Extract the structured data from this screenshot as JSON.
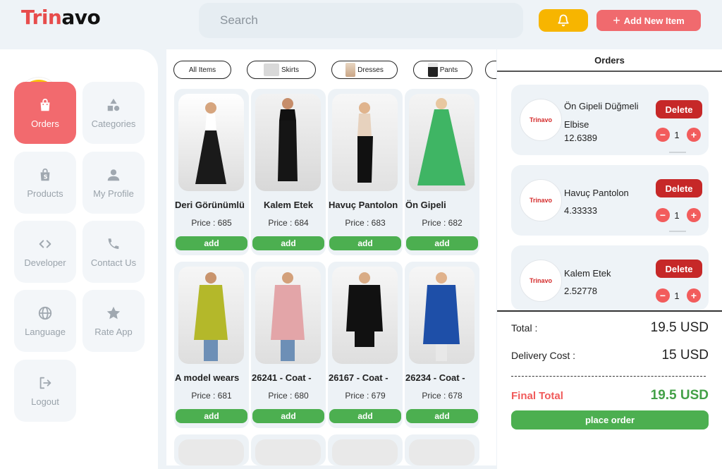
{
  "brand": {
    "part1": "Trin",
    "part2": "avo"
  },
  "search": {
    "placeholder": "Search"
  },
  "header": {
    "bell_icon": "bell-icon",
    "add_new_label": "Add New Item"
  },
  "sidebar": {
    "items": [
      {
        "label": "Orders",
        "icon": "bag-icon",
        "active": true
      },
      {
        "label": "Categories",
        "icon": "shapes-icon"
      },
      {
        "label": "Products",
        "icon": "shopify-bag-icon"
      },
      {
        "label": "My Profile",
        "icon": "user-icon"
      },
      {
        "label": "Developer",
        "icon": "code-icon"
      },
      {
        "label": "Contact Us",
        "icon": "phone-icon"
      },
      {
        "label": "Language",
        "icon": "globe-icon"
      },
      {
        "label": "Rate App",
        "icon": "star-icon"
      },
      {
        "label": "Logout",
        "icon": "logout-icon"
      }
    ]
  },
  "categories": [
    "All Items",
    "Skirts",
    "Dresses",
    "Pants"
  ],
  "products": [
    {
      "name": "Deri Görünümlü",
      "price_label": "Price : 685",
      "add": "add"
    },
    {
      "name": "Kalem Etek",
      "price_label": "Price : 684",
      "add": "add"
    },
    {
      "name": "Havuç Pantolon",
      "price_label": "Price : 683",
      "add": "add"
    },
    {
      "name": "Ön Gipeli",
      "price_label": "Price : 682",
      "add": "add"
    },
    {
      "name": "A model wears",
      "price_label": "Price : 681",
      "add": "add"
    },
    {
      "name": "26241 - Coat -",
      "price_label": "Price : 680",
      "add": "add"
    },
    {
      "name": "26167 - Coat -",
      "price_label": "Price : 679",
      "add": "add"
    },
    {
      "name": "26234 - Coat -",
      "price_label": "Price : 678",
      "add": "add"
    }
  ],
  "orders": {
    "title": "Orders",
    "items": [
      {
        "name": "Ön Gipeli Düğmeli Elbise",
        "value": "12.6389",
        "qty": "1",
        "delete": "Delete",
        "logo": "Trinavo"
      },
      {
        "name": "Havuç Pantolon",
        "value": "4.33333",
        "qty": "1",
        "delete": "Delete",
        "logo": "Trinavo"
      },
      {
        "name": "Kalem Etek",
        "value": "2.52778",
        "qty": "1",
        "delete": "Delete",
        "logo": "Trinavo"
      }
    ]
  },
  "summary": {
    "total_label": "Total :",
    "total_value": "19.5 USD",
    "delivery_label": "Delivery Cost :",
    "delivery_value": "15 USD",
    "final_label": "Final Total",
    "final_value": "19.5 USD",
    "place_order": "place order"
  },
  "colors": {
    "accent": "#f26a6e",
    "green": "#4caf50",
    "bell": "#f7b500",
    "delete": "#c62828"
  }
}
